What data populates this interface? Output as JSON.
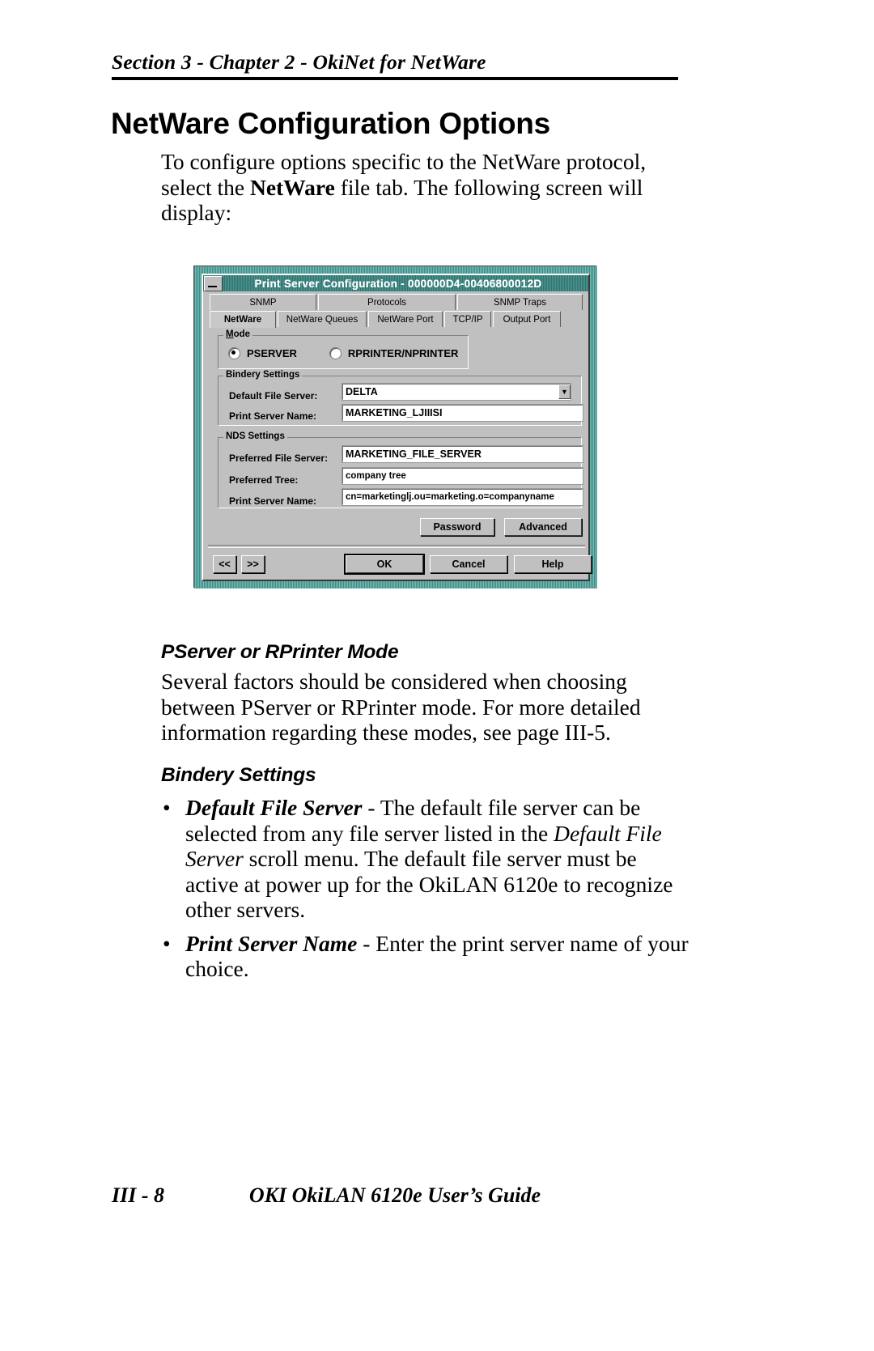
{
  "running_head": "Section 3 - Chapter 2 - OkiNet for NetWare",
  "page_title": "NetWare Configuration Options",
  "intro": {
    "part1": "To configure options specific to the NetWare protocol, select the ",
    "bold": "NetWare",
    "part2": " file tab. The following screen will display:"
  },
  "dialog": {
    "titlebar": "Print Server Configuration - 000000D4-00406800012D",
    "minimize_icon": "minimize-icon",
    "tabs_row1": [
      "SNMP",
      "Protocols",
      "SNMP Traps"
    ],
    "tabs_row2": [
      "NetWare",
      "NetWare Queues",
      "NetWare Port",
      "TCP/IP",
      "Output Port"
    ],
    "active_tab": "NetWare",
    "mode_group": {
      "legend": "Mode",
      "options": [
        {
          "label": "PSERVER",
          "selected": true
        },
        {
          "label": "RPRINTER/NPRINTER",
          "selected": false
        }
      ]
    },
    "bindery_group": {
      "legend": "Bindery Settings",
      "fields": [
        {
          "label": "Default File Server:",
          "value": "DELTA",
          "has_dropdown": true,
          "dropdown_icon": "chevron-down-icon"
        },
        {
          "label": "Print Server Name:",
          "value": "MARKETING_LJIIISI",
          "has_dropdown": false
        }
      ]
    },
    "nds_group": {
      "legend": "NDS Settings",
      "fields": [
        {
          "label": "Preferred File Server:",
          "value": "MARKETING_FILE_SERVER"
        },
        {
          "label": "Preferred Tree:",
          "value": "company tree"
        },
        {
          "label": "Print Server Name:",
          "value": "cn=marketinglj.ou=marketing.o=companyname"
        }
      ]
    },
    "action_buttons": [
      "Password",
      "Advanced"
    ],
    "nav_buttons": [
      "<<",
      ">>"
    ],
    "footer_buttons": [
      "OK",
      "Cancel",
      "Help"
    ],
    "colors": {
      "titlebar": "#2c7672",
      "face": "#c0c0c0",
      "frame": "#3c8e88"
    }
  },
  "section_pserver": {
    "heading": "PServer or RPrinter Mode",
    "body": "Several factors should be considered when choosing between PServer or RPrinter mode. For more detailed information regarding these modes, see page III-5."
  },
  "section_bindery": {
    "heading": "Bindery Settings",
    "bullets": [
      {
        "term": "Default File Server",
        "dash": " - ",
        "text_a": "The default file server can be selected from any file server listed in the ",
        "italic": "Default File Server",
        "text_b": " scroll menu. The default file server must be active at power up for the OkiLAN 6120e to recognize other servers."
      },
      {
        "term": "Print Server Name",
        "dash": " - ",
        "text_a": "Enter the print server name of your choice.",
        "italic": "",
        "text_b": ""
      }
    ]
  },
  "footer": {
    "page_number": "III - 8",
    "guide": "OKI OkiLAN 6120e User’s Guide"
  }
}
